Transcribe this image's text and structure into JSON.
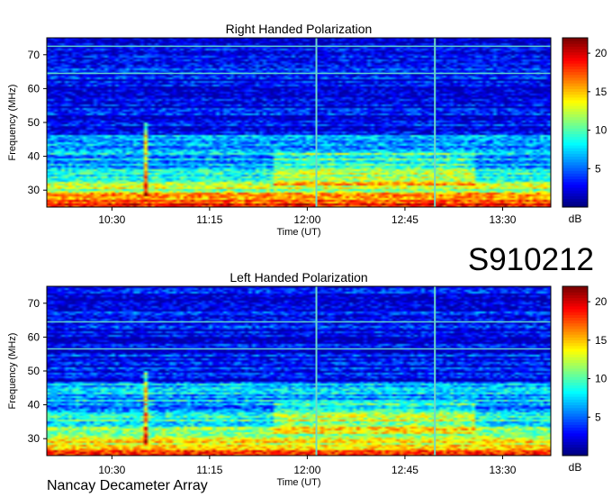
{
  "figure": {
    "observation_id": "S910212",
    "footer": "Nancay Decameter Array"
  },
  "colors": {
    "spectrum": [
      "#000080",
      "#0000ff",
      "#0080ff",
      "#00ffff",
      "#80ff80",
      "#ffff00",
      "#ff8000",
      "#ff0000",
      "#800000"
    ],
    "frame": "#000000",
    "background": "#ffffff"
  },
  "chart_data": [
    {
      "type": "heatmap",
      "title": "Right Handed Polarization",
      "xlabel": "Time (UT)",
      "ylabel": "Frequency (MHz)",
      "xticks": [
        "10:30",
        "11:15",
        "12:00",
        "12:45",
        "13:30"
      ],
      "xtick_hours": [
        10.5,
        11.25,
        12.0,
        12.75,
        13.5
      ],
      "xlim_hours": [
        10.0,
        13.87
      ],
      "yticks": [
        30,
        40,
        50,
        60,
        70
      ],
      "ylim": [
        25,
        75
      ],
      "colorbar": {
        "label": "dB",
        "ticks": [
          5,
          10,
          15,
          20
        ],
        "range": [
          0,
          22
        ]
      },
      "features": {
        "vertical_lines_hours": [
          12.07,
          12.98
        ],
        "short_burst_hours": 10.75,
        "horizontal_lines_mhz": [
          72.5,
          64.5
        ]
      }
    },
    {
      "type": "heatmap",
      "title": "Left Handed Polarization",
      "xlabel": "Time (UT)",
      "ylabel": "Frequency (MHz)",
      "xticks": [
        "10:30",
        "11:15",
        "12:00",
        "12:45",
        "13:30"
      ],
      "xtick_hours": [
        10.5,
        11.25,
        12.0,
        12.75,
        13.5
      ],
      "xlim_hours": [
        10.0,
        13.87
      ],
      "yticks": [
        30,
        40,
        50,
        60,
        70
      ],
      "ylim": [
        25,
        75
      ],
      "colorbar": {
        "label": "dB",
        "ticks": [
          5,
          10,
          15,
          20
        ],
        "range": [
          0,
          22
        ]
      },
      "features": {
        "vertical_lines_hours": [
          12.07,
          12.98
        ],
        "short_burst_hours": 10.75,
        "horizontal_lines_mhz": [
          64.5,
          56.5
        ]
      }
    }
  ]
}
